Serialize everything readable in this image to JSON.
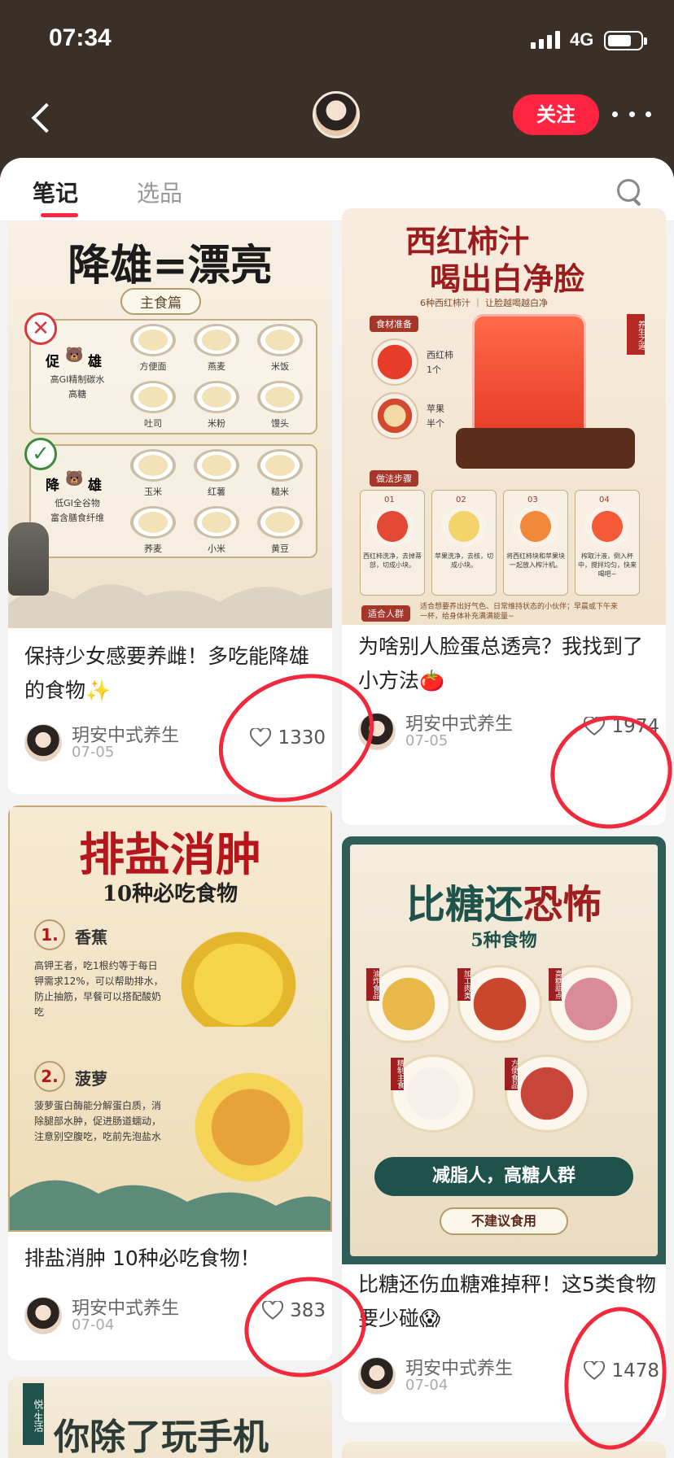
{
  "status_bar": {
    "time": "07:34",
    "network": "4G"
  },
  "header": {
    "follow_label": "关注"
  },
  "tabs": {
    "notes": "笔记",
    "picks": "选品"
  },
  "cards": [
    {
      "cover_title": "降雄=漂亮",
      "cover_subtitle": "主食篇",
      "cover_bad_label": "促",
      "cover_bad_label_2": "雄",
      "cover_bad_desc": "高GI精制碳水\n高糖",
      "cover_bad_foods": [
        "方便面",
        "燕麦",
        "米饭",
        "吐司",
        "米粉",
        "馒头"
      ],
      "cover_good_label": "降",
      "cover_good_label_2": "雄",
      "cover_good_desc": "低GI全谷物\n富含膳食纤维",
      "cover_good_foods": [
        "玉米",
        "红薯",
        "糙米",
        "荞麦",
        "小米",
        "黄豆"
      ],
      "title": "保持少女感要养雌！多吃能降雄的食物✨",
      "author": "玥安中式养生",
      "date": "07-05",
      "likes": "1330"
    },
    {
      "cover_title_1": "西红柿汁",
      "cover_title_2": "喝出白净脸",
      "cover_subtitle": "6种西红柿汁 ｜ 让脸越喝越白净",
      "cover_ingredients_label": "食材准备",
      "cover_ingredients": [
        "西红柿\n1个",
        "苹果\n半个"
      ],
      "cover_steps_label": "做法步骤",
      "cover_steps": [
        "01",
        "02",
        "03",
        "04"
      ],
      "cover_steps_text": [
        "西红柿洗净，去掉蒂部，切成小块。",
        "苹果洗净，去核，切成小块。",
        "将西红柿块和苹果块一起放入榨汁机。",
        "榨取汁液，倒入杯中，搅拌均匀，快来喝吧~"
      ],
      "cover_people_label": "适合人群",
      "cover_people_text": "适合想要养出好气色、日常维持状态的小伙伴；早晨或下午来一杯，给身体补充满满能量~",
      "cover_seal": "养生之道",
      "title": "为啥别人脸蛋总透亮？我找到了小方法🍅",
      "author": "玥安中式养生",
      "date": "07-05",
      "likes": "1974"
    },
    {
      "cover_title": "排盐消肿",
      "cover_subtitle": "10种必吃食物",
      "cover_item1_num": "1.",
      "cover_item1_name": "香蕉",
      "cover_item1_desc": "高钾王者，吃1根约等于每日钾需求12%，可以帮助排水，防止抽筋，早餐可以搭配酸奶吃",
      "cover_item2_num": "2.",
      "cover_item2_name": "菠萝",
      "cover_item2_desc": "菠萝蛋白酶能分解蛋白质，消除腿部水肿，促进肠道蠕动，注意别空腹吃，吃前先泡盐水",
      "title": "排盐消肿 10种必吃食物！",
      "author": "玥安中式养生",
      "date": "07-04",
      "likes": "383"
    },
    {
      "cover_title_a": "比糖还",
      "cover_title_b": "恐怖",
      "cover_subtitle": "5种食物",
      "cover_tags": [
        "油炸食品",
        "加工肉类",
        "高糖甜点",
        "精制主食",
        "方便食品"
      ],
      "cover_banner": "减脂人，高糖人群",
      "cover_banner_sub": "不建议食用",
      "title": "比糖还伤血糖难掉秤！这5类食物要少碰😱",
      "author": "玥安中式养生",
      "date": "07-04",
      "likes": "1478"
    },
    {
      "cover_tag": "悦·生活",
      "cover_title": "你除了玩手机"
    }
  ],
  "colors": {
    "brand_red": "#ff2442",
    "header_bg": "#3a3027",
    "marker_red": "#f02a3c"
  },
  "icons": [
    "back-icon",
    "avatar",
    "more-icon",
    "search-icon",
    "heart-icon",
    "signal-icon",
    "battery-icon"
  ]
}
